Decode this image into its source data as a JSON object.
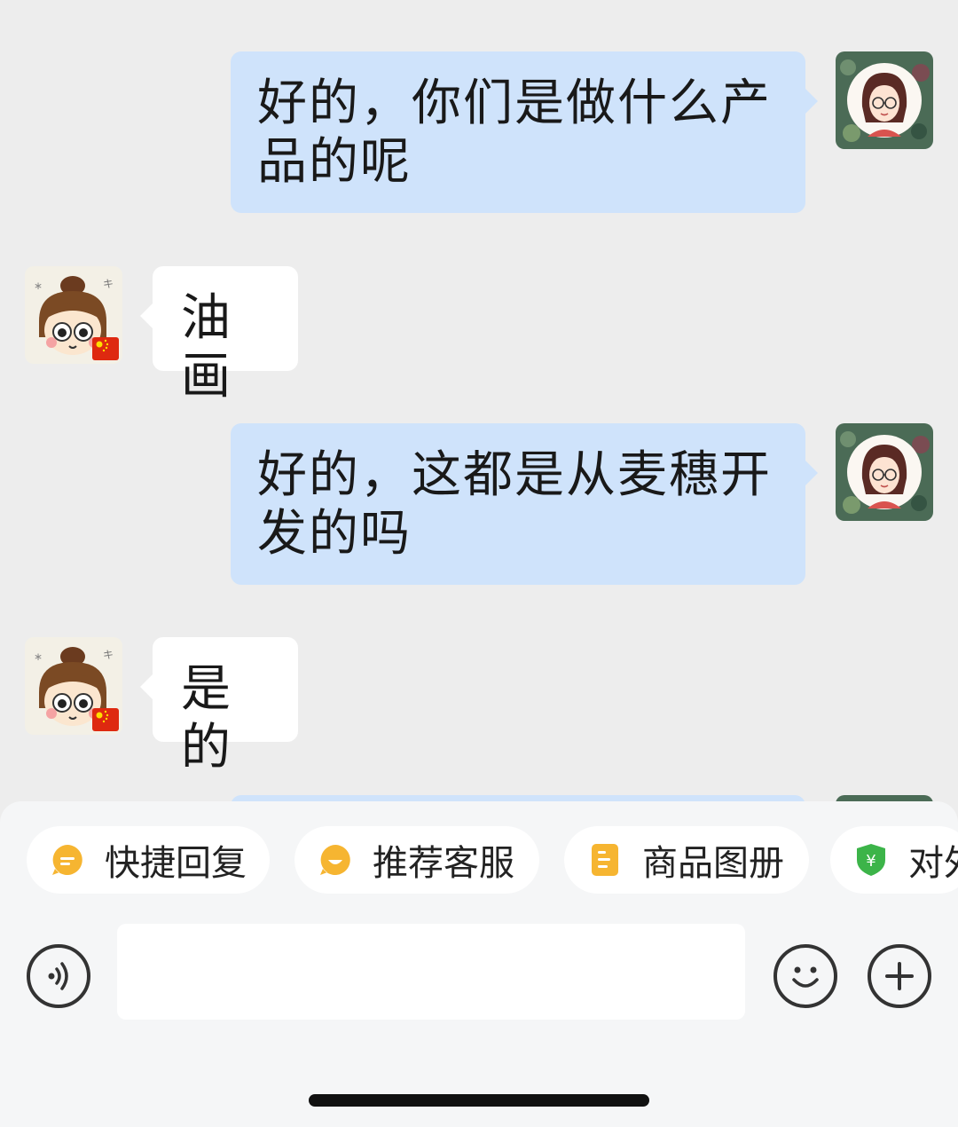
{
  "messages": [
    {
      "side": "out",
      "text": "好的，你们是做什么产品的呢"
    },
    {
      "side": "in",
      "text": "油画"
    },
    {
      "side": "out",
      "text": "好的，这都是从麦穗开发的吗"
    },
    {
      "side": "in",
      "text": "是的"
    }
  ],
  "avatars": {
    "self": "girl-with-glasses-avatar",
    "contact": "cartoon-girl-avatar",
    "contact_badge": "china-flag-icon"
  },
  "quick_actions": [
    {
      "label": "快捷回复",
      "icon": "quick-reply-icon",
      "color": "#f6b531"
    },
    {
      "label": "推荐客服",
      "icon": "service-icon",
      "color": "#f6b531"
    },
    {
      "label": "商品图册",
      "icon": "album-icon",
      "color": "#f6b531"
    },
    {
      "label": "对外",
      "icon": "payment-shield-icon",
      "color": "#3cb449"
    }
  ],
  "input": {
    "value": "",
    "placeholder": ""
  },
  "icons": {
    "voice": "voice-icon",
    "emoji": "emoji-icon",
    "more": "plus-icon"
  },
  "colors": {
    "background": "#ededed",
    "outgoing_bubble": "#cfe3fb",
    "incoming_bubble": "#ffffff"
  }
}
